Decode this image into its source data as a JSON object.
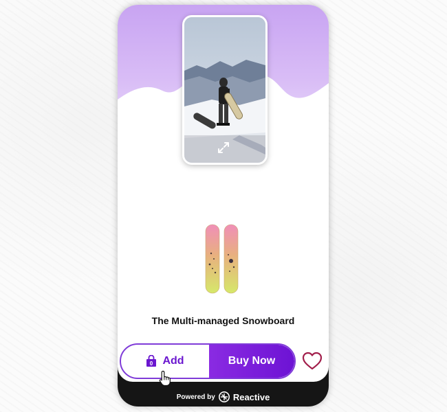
{
  "product": {
    "title": "The Multi-managed Snowboard",
    "video_icon": "expand-icon",
    "image_icon": "snowboard-image"
  },
  "actions": {
    "add_label": "Add",
    "add_icon": "shopping-bag-icon",
    "buy_label": "Buy Now",
    "wishlist_icon": "heart-icon"
  },
  "footer": {
    "powered_by": "Powered by",
    "brand": "Reactive",
    "brand_icon": "reactive-logo-icon"
  },
  "colors": {
    "accent": "#7f3bd8",
    "buy_button": "#6d13d4",
    "hero_top": "#c8a4f2",
    "wishlist": "#a11d4a",
    "footer": "#151515"
  }
}
